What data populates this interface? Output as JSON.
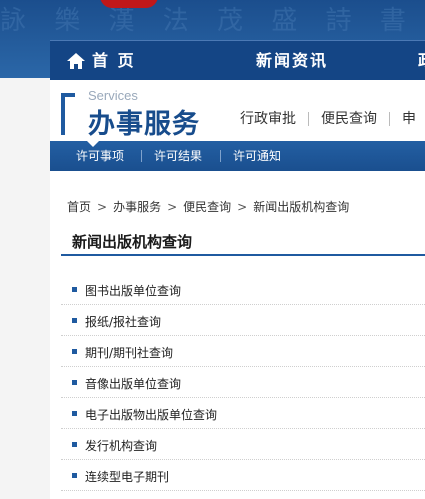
{
  "banner": {
    "glyph_text": "詠 樂 漢 法 茂 盛 詩 書 文 字"
  },
  "topnav": {
    "home_label": "首 页",
    "news_label": "新闻资讯",
    "more_label": "政"
  },
  "section": {
    "title_en": "Services",
    "title_cn": "办事服务",
    "tabs": [
      "行政审批",
      "便民查询",
      "申"
    ],
    "subnav": [
      "许可事项",
      "许可结果",
      "许可通知"
    ]
  },
  "breadcrumb": [
    "首页",
    "办事服务",
    "便民查询",
    "新闻出版机构查询"
  ],
  "breadcrumb_sep": ">",
  "page": {
    "title": "新闻出版机构查询"
  },
  "links": [
    "图书出版单位查询",
    "报纸/报社查询",
    "期刊/期刊社查询",
    "音像出版单位查询",
    "电子出版物出版单位查询",
    "发行机构查询",
    "连续型电子期刊"
  ],
  "colors": {
    "nav_bg": "#144585",
    "accent": "#1f5aa0",
    "banner": "#245c9c"
  }
}
